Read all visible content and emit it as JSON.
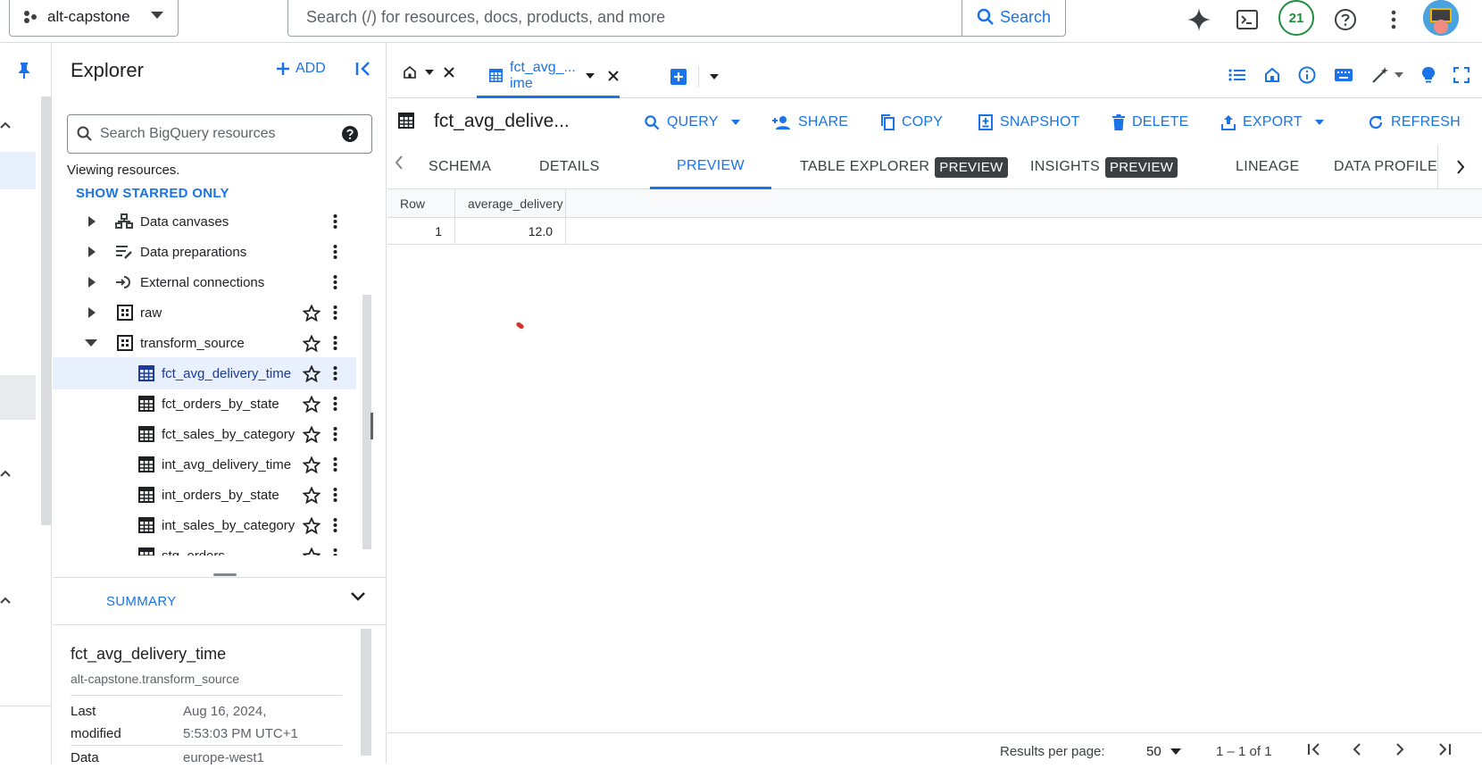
{
  "topbar": {
    "project_name": "alt-capstone",
    "search_placeholder": "Search (/) for resources, docs, products, and more",
    "search_button": "Search",
    "notifications_count": "21"
  },
  "explorer": {
    "title": "Explorer",
    "add_label": "ADD",
    "search_placeholder": "Search BigQuery resources",
    "viewing_text": "Viewing resources.",
    "starred_link": "SHOW STARRED ONLY",
    "tree": [
      {
        "label": "Data canvases",
        "icon": "data-canvas-icon"
      },
      {
        "label": "Data preparations",
        "icon": "data-prep-icon"
      },
      {
        "label": "External connections",
        "icon": "connection-icon"
      },
      {
        "label": "raw",
        "icon": "dataset-icon"
      },
      {
        "label": "transform_source",
        "icon": "dataset-icon"
      },
      {
        "label": "fct_avg_delivery_time",
        "icon": "table-icon"
      },
      {
        "label": "fct_orders_by_state",
        "icon": "table-icon"
      },
      {
        "label": "fct_sales_by_category",
        "icon": "table-icon"
      },
      {
        "label": "int_avg_delivery_time",
        "icon": "table-icon"
      },
      {
        "label": "int_orders_by_state",
        "icon": "table-icon"
      },
      {
        "label": "int_sales_by_category",
        "icon": "table-icon"
      },
      {
        "label": "stg_orders",
        "icon": "table-icon"
      }
    ]
  },
  "summary": {
    "header": "SUMMARY",
    "name": "fct_avg_delivery_time",
    "path": "alt-capstone.transform_source",
    "last_modified_key_1": "Last",
    "last_modified_key_2": "modified",
    "last_modified_val_1": "Aug 16, 2024,",
    "last_modified_val_2": "5:53:03 PM UTC+1",
    "data_key": "Data",
    "data_val": "europe-west1"
  },
  "tabs": {
    "active_tab_label": "fct_avg_... ime"
  },
  "toolbar": {
    "title": "fct_avg_delive...",
    "query": "QUERY",
    "share": "SHARE",
    "copy": "COPY",
    "snapshot": "SNAPSHOT",
    "delete": "DELETE",
    "export": "EXPORT",
    "refresh": "REFRESH"
  },
  "subtabs": {
    "schema": "SCHEMA",
    "details": "DETAILS",
    "preview": "PREVIEW",
    "table_explorer": "TABLE EXPLORER",
    "table_explorer_badge": "PREVIEW",
    "insights": "INSIGHTS",
    "insights_badge": "PREVIEW",
    "lineage": "LINEAGE",
    "data_profile": "DATA PROFILE"
  },
  "grid": {
    "columns": [
      "Row",
      "average_delivery"
    ],
    "rows": [
      [
        "1",
        "12.0"
      ]
    ]
  },
  "footer": {
    "results_per_page_label": "Results per page:",
    "results_per_page_value": "50",
    "range": "1 – 1 of 1"
  },
  "colors": {
    "accent": "#1a73e8",
    "selected_bg": "#e8f0fe",
    "badge_bg": "#3c4043"
  }
}
